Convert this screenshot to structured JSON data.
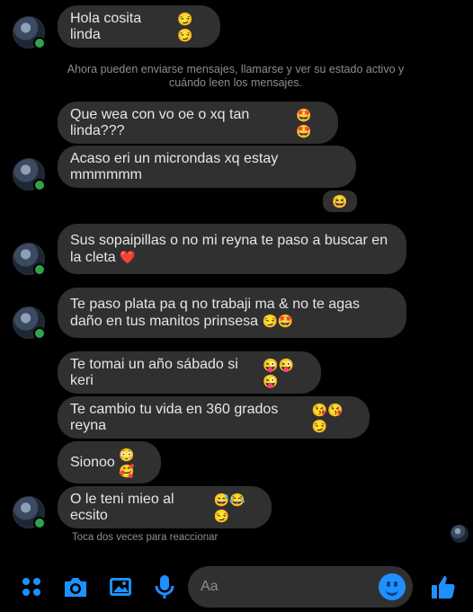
{
  "notice": "Ahora pueden enviarse mensajes, llamarse y ver su estado activo y cuándo leen los mensajes.",
  "messages": [
    {
      "text": "Hola cosita linda",
      "emoji": "😏😏"
    },
    {
      "text": "Que wea con vo oe o xq tan linda???",
      "emoji": "🤩🤩"
    },
    {
      "text": "Acaso eri un microndas xq estay mmmmmm",
      "emoji": ""
    },
    {
      "text": "Sus sopaipillas o no mi reyna te paso a buscar en la cleta",
      "emoji": "❤️"
    },
    {
      "text": "Te paso plata pa q no trabaji ma & no te agas daño en tus manitos prinsesa",
      "emoji": "😏🤩"
    },
    {
      "text": "Te tomai un año sábado si keri",
      "emoji": "😜😜😜"
    },
    {
      "text": "Te cambio tu vida en 360 grados reyna",
      "emoji": "😘😘😏"
    },
    {
      "text": "Sionoo",
      "emoji": "😳🥰"
    },
    {
      "text": "O le teni mieo al ecsito",
      "emoji": "😅😂😏"
    }
  ],
  "reaction": "😆",
  "hint": "Toca dos veces para reaccionar",
  "composer": {
    "placeholder": "Aa"
  },
  "colors": {
    "accent": "#1e90ff",
    "bubble": "#303030",
    "background": "#000000"
  },
  "icons": [
    "grid-icon",
    "camera-icon",
    "image-icon",
    "microphone-icon",
    "emoji-icon",
    "thumbs-up-icon"
  ]
}
